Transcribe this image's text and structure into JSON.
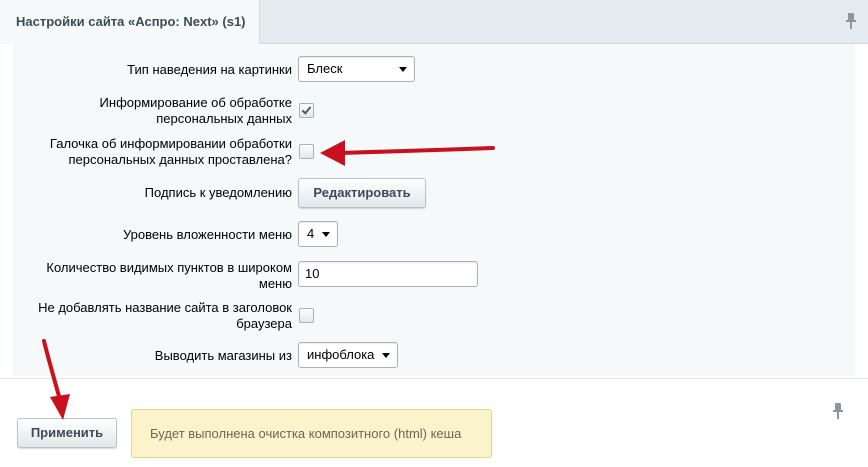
{
  "tab": {
    "title": "Настройки сайта «Аспро: Next» (s1)"
  },
  "settings": {
    "hover_type": {
      "label": "Тип наведения на картинки",
      "value": "Блеск"
    },
    "inform_processing": {
      "label_line1": "Информирование об обработке",
      "label_line2": "персональных данных",
      "checked": true
    },
    "inform_checkbox_default": {
      "label_line1": "Галочка об информировании обработки",
      "label_line2": "персональных данных проставлена?",
      "checked": false
    },
    "notification_signature": {
      "label": "Подпись к уведомлению",
      "button_label": "Редактировать"
    },
    "menu_depth": {
      "label": "Уровень вложенности меню",
      "value": "4"
    },
    "wide_menu_items": {
      "label_line1": "Количество видимых пунктов в широком",
      "label_line2": "меню",
      "value": "10"
    },
    "no_site_name_title": {
      "label_line1": "Не добавлять название сайта в заголовок",
      "label_line2": "браузера",
      "checked": false
    },
    "stores_source": {
      "label": "Выводить магазины из",
      "value": "инфоблока"
    }
  },
  "footer": {
    "apply_label": "Применить",
    "notice": "Будет выполнена очистка композитного (html) кеша"
  },
  "colors": {
    "arrow": "#c8101e",
    "notice_bg": "#fbf3cc",
    "panel_bg": "#f5f9f9"
  },
  "icons": {
    "pin": "pin-icon",
    "caret": "chevron-down-icon",
    "check": "checkmark-icon"
  }
}
